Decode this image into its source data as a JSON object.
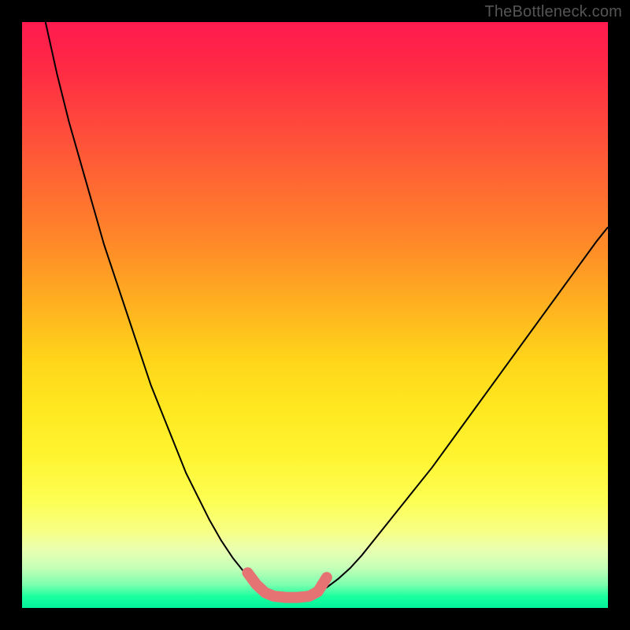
{
  "watermark": "TheBottleneck.com",
  "layout": {
    "frame_size": 800,
    "plot_left": 28,
    "plot_top": 28,
    "plot_right": 28,
    "plot_bottom": 28
  },
  "chart_data": {
    "type": "line",
    "title": "",
    "xlabel": "",
    "ylabel": "",
    "xlim": [
      0,
      100
    ],
    "ylim": [
      0,
      100
    ],
    "legend": false,
    "grid": false,
    "series": [
      {
        "name": "left-curve",
        "stroke": "#000000",
        "stroke_width": 2,
        "x": [
          4,
          6,
          8,
          10,
          12,
          14,
          16,
          18,
          20,
          22,
          24,
          26,
          28,
          30,
          32,
          34,
          36,
          38,
          40,
          42
        ],
        "values": [
          100,
          91,
          83,
          76,
          69,
          62,
          56,
          50,
          44,
          38,
          33,
          28,
          23,
          19,
          15,
          11.5,
          8.5,
          6,
          4,
          2.5
        ]
      },
      {
        "name": "right-curve",
        "stroke": "#000000",
        "stroke_width": 2,
        "x": [
          50,
          52,
          54,
          56,
          58,
          62,
          66,
          70,
          74,
          78,
          82,
          86,
          90,
          94,
          98,
          100
        ],
        "values": [
          2.5,
          3.5,
          5,
          6.8,
          9,
          14,
          19,
          24,
          29.5,
          35,
          40.5,
          46,
          51.5,
          57,
          62.5,
          65
        ]
      },
      {
        "name": "highlight-band",
        "stroke": "#e57373",
        "stroke_width": 14,
        "linecap": "round",
        "x": [
          38.5,
          40,
          41.5,
          43,
          45,
          47,
          49,
          50.5,
          52
        ],
        "values": [
          6,
          4,
          2.6,
          2,
          1.8,
          1.8,
          2,
          2.8,
          5.2
        ]
      }
    ]
  }
}
